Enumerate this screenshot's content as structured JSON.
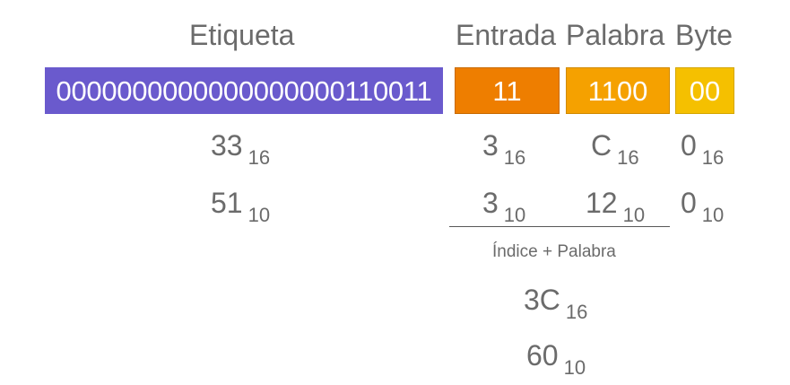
{
  "headers": {
    "tag": "Etiqueta",
    "entry": "Entrada",
    "word": "Palabra",
    "byte": "Byte"
  },
  "fields": {
    "tag_bits": "0000000000000000000110011",
    "entry_bits": "11",
    "word_bits": "1100",
    "byte_bits": "00"
  },
  "hex_row": {
    "tag": "33",
    "tag_base": "16",
    "entry": "3",
    "entry_base": "16",
    "word": "C",
    "word_base": "16",
    "byte": "0",
    "byte_base": "16"
  },
  "dec_row": {
    "tag": "51",
    "tag_base": "10",
    "entry": "3",
    "entry_base": "10",
    "word": "12",
    "word_base": "10",
    "byte": "0",
    "byte_base": "10"
  },
  "combined": {
    "caption": "Índice + Palabra",
    "hex": "3C",
    "hex_base": "16",
    "dec": "60",
    "dec_base": "10"
  },
  "colors": {
    "tag_fill": "#6a5acd",
    "entry_fill": "#ee7e00",
    "word_fill": "#f5a100",
    "byte_fill": "#f5c000",
    "text_gray": "#6b6b6b"
  }
}
